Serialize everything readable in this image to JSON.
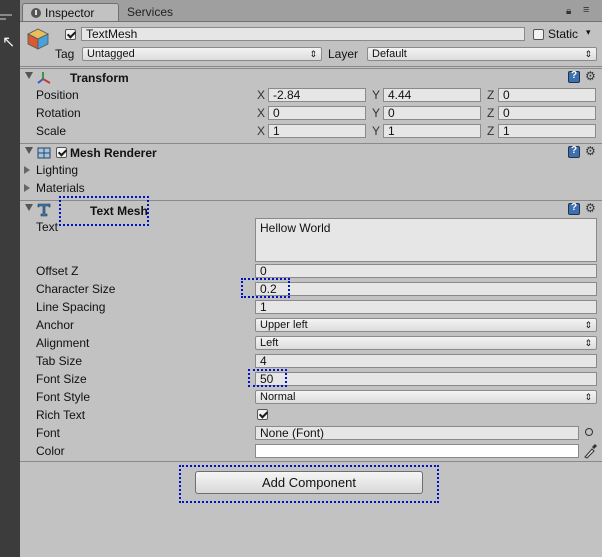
{
  "tabs": [
    {
      "label": "Inspector",
      "icon": "info-icon"
    },
    {
      "label": "Services"
    }
  ],
  "header": {
    "object_name": "TextMesh",
    "active": true,
    "static_label": "Static",
    "tag_label": "Tag",
    "tag_value": "Untagged",
    "layer_label": "Layer",
    "layer_value": "Default"
  },
  "transform": {
    "title": "Transform",
    "rows": [
      {
        "label": "Position",
        "x": "-2.84",
        "y": "4.44",
        "z": "0"
      },
      {
        "label": "Rotation",
        "x": "0",
        "y": "0",
        "z": "0"
      },
      {
        "label": "Scale",
        "x": "1",
        "y": "1",
        "z": "1"
      }
    ],
    "axis": [
      "X",
      "Y",
      "Z"
    ]
  },
  "mesh_renderer": {
    "title": "Mesh Renderer",
    "enabled": true,
    "sections": [
      "Lighting",
      "Materials"
    ]
  },
  "text_mesh": {
    "title": "Text Mesh",
    "text_label": "Text",
    "text_value": "Hellow World",
    "fields": [
      {
        "label": "Offset Z",
        "value": "0",
        "kind": "field"
      },
      {
        "label": "Character Size",
        "value": "0.2",
        "kind": "field"
      },
      {
        "label": "Line Spacing",
        "value": "1",
        "kind": "field"
      },
      {
        "label": "Anchor",
        "value": "Upper left",
        "kind": "dropdown"
      },
      {
        "label": "Alignment",
        "value": "Left",
        "kind": "dropdown"
      },
      {
        "label": "Tab Size",
        "value": "4",
        "kind": "field"
      },
      {
        "label": "Font Size",
        "value": "50",
        "kind": "field"
      },
      {
        "label": "Font Style",
        "value": "Normal",
        "kind": "dropdown"
      },
      {
        "label": "Rich Text",
        "value": true,
        "kind": "checkbox"
      },
      {
        "label": "Font",
        "value": "None (Font)",
        "kind": "object"
      },
      {
        "label": "Color",
        "value": "#ffffff",
        "kind": "color"
      }
    ]
  },
  "add_component_label": "Add Component",
  "highlight_color": "#0012c8"
}
